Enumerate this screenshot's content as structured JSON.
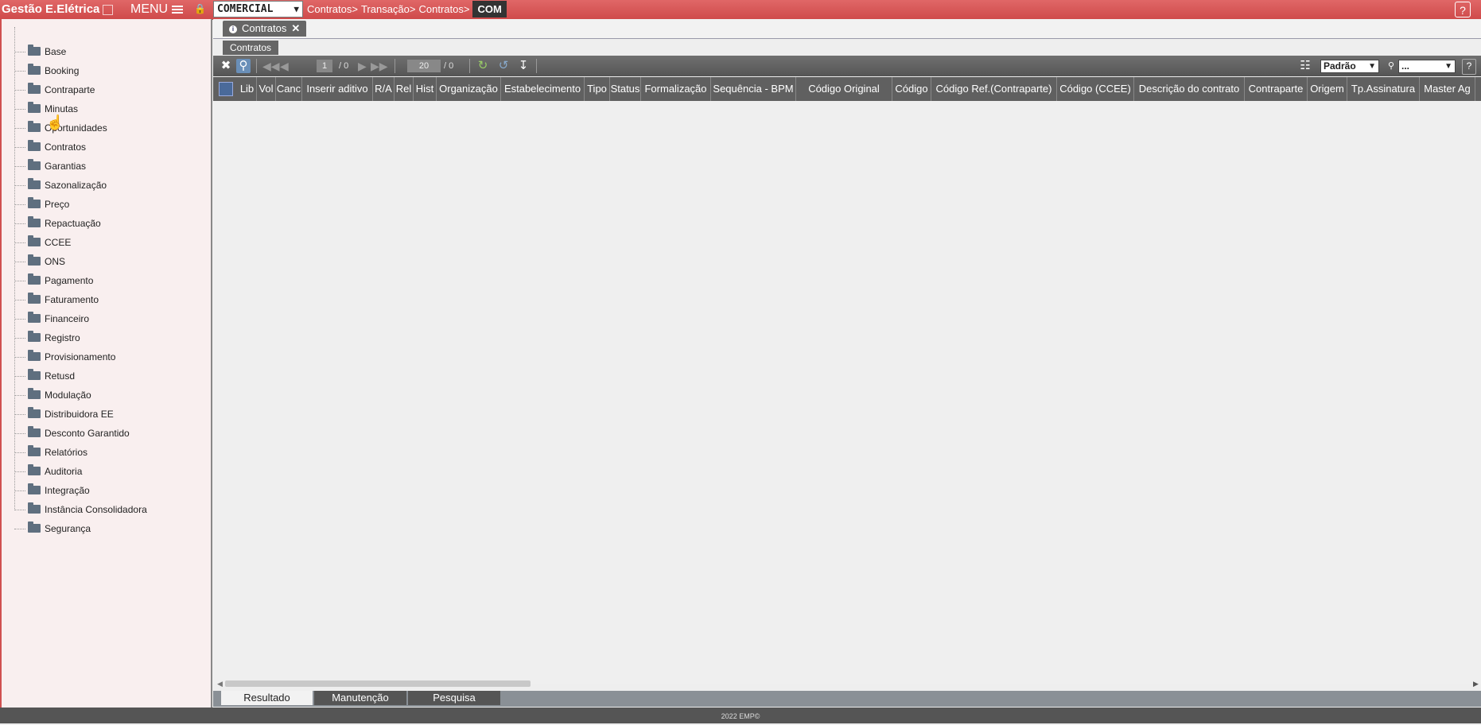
{
  "app": {
    "title": "Gestão E.Elétrica",
    "menu_label": "MENU",
    "module": "COMERCIAL",
    "breadcrumb": [
      "Contratos>",
      "Transação>",
      "Contratos>"
    ],
    "screen_code": "COM",
    "help": "?"
  },
  "sidebar": {
    "items": [
      {
        "label": "Base"
      },
      {
        "label": "Booking"
      },
      {
        "label": "Contraparte"
      },
      {
        "label": "Minutas"
      },
      {
        "label": "Oportunidades"
      },
      {
        "label": "Contratos"
      },
      {
        "label": "Garantias"
      },
      {
        "label": "Sazonalização"
      },
      {
        "label": "Preço"
      },
      {
        "label": "Repactuação"
      },
      {
        "label": "CCEE"
      },
      {
        "label": "ONS"
      },
      {
        "label": "Pagamento"
      },
      {
        "label": "Faturamento"
      },
      {
        "label": "Financeiro"
      },
      {
        "label": "Registro"
      },
      {
        "label": "Provisionamento"
      },
      {
        "label": "Retusd"
      },
      {
        "label": "Modulação"
      },
      {
        "label": "Distribuidora EE"
      },
      {
        "label": "Desconto Garantido"
      },
      {
        "label": "Relatórios"
      },
      {
        "label": "Auditoria"
      },
      {
        "label": "Integração"
      },
      {
        "label": "Instância Consolidadora"
      },
      {
        "label": "Segurança"
      }
    ]
  },
  "tabs": {
    "main_tab": "Contratos",
    "sub_tab": "Contratos"
  },
  "toolbar": {
    "page_current": "1",
    "page_total": "/ 0",
    "page_size": "20",
    "record_total": "/ 0",
    "view_select": "Padrão",
    "filter_select": "...",
    "help": "?"
  },
  "grid": {
    "columns": [
      "Lib",
      "Vol",
      "Canc",
      "Inserir aditivo",
      "R/A",
      "Rel",
      "Hist",
      "Organização",
      "Estabelecimento",
      "Tipo",
      "Status",
      "Formalização",
      "Sequência - BPM",
      "Código Original",
      "Código",
      "Código Ref.(Contraparte)",
      "Código (CCEE)",
      "Descrição do contrato",
      "Contraparte",
      "Origem",
      "Tp.Assinatura",
      "Master Ag"
    ]
  },
  "bottom_tabs": [
    "Resultado",
    "Manutenção",
    "Pesquisa"
  ],
  "footer": "2022 EMP©"
}
